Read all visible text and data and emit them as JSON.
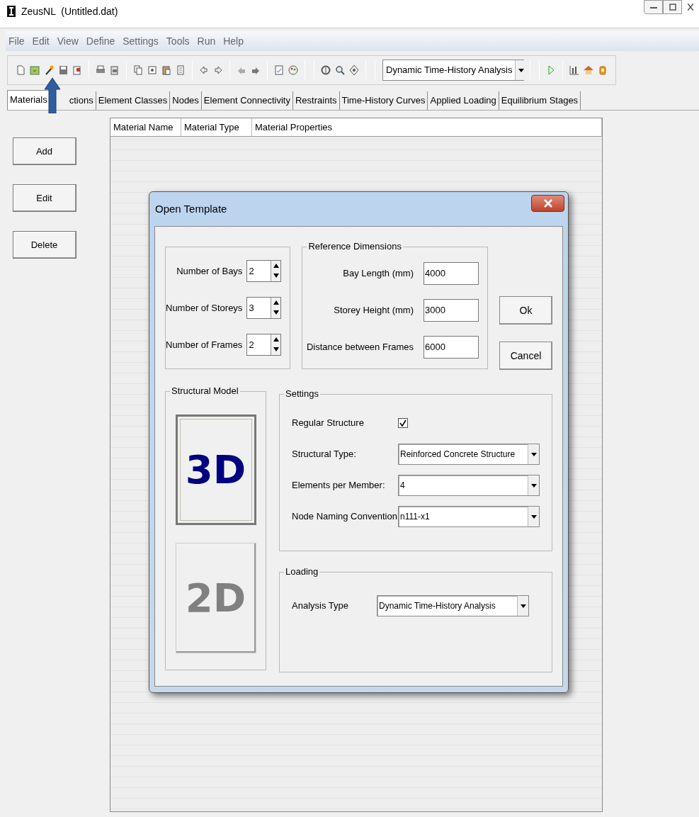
{
  "window": {
    "title": "ZeusNL  (Untitled.dat)"
  },
  "menu": [
    "File",
    "Edit",
    "View",
    "Define",
    "Settings",
    "Tools",
    "Run",
    "Help"
  ],
  "toolbar": {
    "analysis_type": "Dynamic Time-History Analysis"
  },
  "tabs": [
    {
      "label": "Materials",
      "selected": true
    },
    {
      "label": "ctions",
      "selected": false
    },
    {
      "label": "Element Classes",
      "selected": false
    },
    {
      "label": "Nodes",
      "selected": false
    },
    {
      "label": "Element Connectivity",
      "selected": false
    },
    {
      "label": "Restraints",
      "selected": false
    },
    {
      "label": "Time-History Curves",
      "selected": false
    },
    {
      "label": "Applied Loading",
      "selected": false
    },
    {
      "label": "Equilibrium Stages",
      "selected": false
    }
  ],
  "side_buttons": [
    "Add",
    "Edit",
    "Delete"
  ],
  "table": {
    "columns": [
      "Material Name",
      "Material Type",
      "Material Properties"
    ]
  },
  "dialog": {
    "title": "Open Template",
    "counts": [
      {
        "label": "Number of Bays",
        "value": "2"
      },
      {
        "label": "Number of Storeys",
        "value": "3"
      },
      {
        "label": "Number of Frames",
        "value": "2"
      }
    ],
    "reference_dimensions": {
      "title": "Reference Dimensions",
      "fields": [
        {
          "label": "Bay Length (mm)",
          "value": "4000"
        },
        {
          "label": "Storey Height (mm)",
          "value": "3000"
        },
        {
          "label": "Distance between Frames",
          "value": "6000"
        }
      ]
    },
    "buttons": [
      "Ok",
      "Cancel"
    ],
    "structural_model": {
      "title": "Structural Model",
      "options": [
        {
          "label": "3D",
          "selected": true
        },
        {
          "label": "2D",
          "selected": false
        }
      ]
    },
    "settings": {
      "title": "Settings",
      "rows": [
        {
          "kind": "checkbox",
          "label": "Regular Structure",
          "checked": true
        },
        {
          "kind": "dropdown",
          "label": "Structural Type:",
          "value": "Reinforced Concrete Structure"
        },
        {
          "kind": "dropdown",
          "label": "Elements per Member:",
          "value": "4"
        },
        {
          "kind": "dropdown",
          "label": "Node Naming Convention",
          "value": "n111-x1"
        }
      ]
    },
    "loading": {
      "title": "Loading",
      "rows": [
        {
          "kind": "dropdown",
          "label": "Analysis Type",
          "value": "Dynamic Time-History Analysis"
        }
      ]
    }
  }
}
